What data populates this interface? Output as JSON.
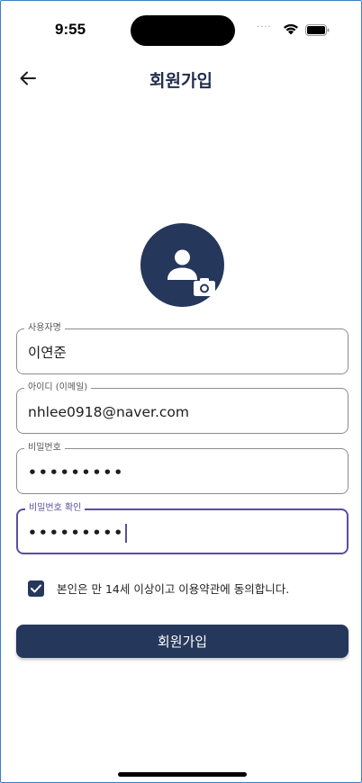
{
  "status_bar": {
    "time": "9:55",
    "signal_icon": "signal-dots",
    "wifi_icon": "wifi-icon",
    "battery_icon": "battery-icon"
  },
  "header": {
    "back_icon": "arrow-left-icon",
    "title": "회원가입"
  },
  "avatar": {
    "icon": "person-icon",
    "camera_icon": "camera-icon"
  },
  "form": {
    "username": {
      "label": "사용자명",
      "value": "이연준"
    },
    "id": {
      "label": "아이디 (이메일)",
      "value": "nhlee0918@naver.com"
    },
    "password": {
      "label": "비밀번호",
      "value": "•••••••••"
    },
    "password_confirm": {
      "label": "비밀번호 확인",
      "value": "•••••••••"
    }
  },
  "agree": {
    "checked": true,
    "text": "본인은 만 14세 이상이고 이용약관에 동의합니다."
  },
  "submit": {
    "label": "회원가입"
  },
  "colors": {
    "primary": "#25375a",
    "title": "#1f2d4e",
    "focus": "#5b4e9e",
    "border": "#8d8d8d"
  }
}
